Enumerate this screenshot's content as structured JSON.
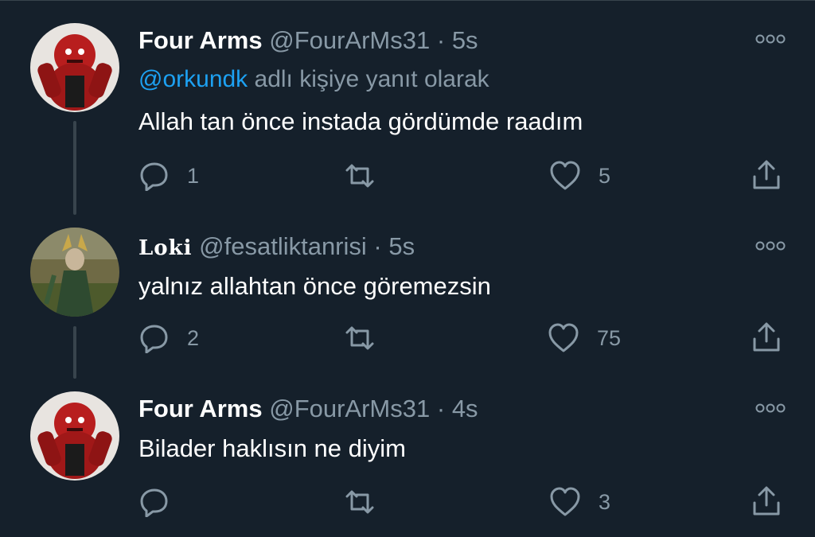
{
  "tweets": [
    {
      "name": "Four Arms",
      "handle": "@FourArMs31",
      "separator": "·",
      "time": "5s",
      "reply_mention": "@orkundk",
      "reply_suffix": " adlı kişiye yanıt olarak",
      "text": "Allah tan önce instada gördümde raadım",
      "reply_count": "1",
      "retweet_count": "",
      "like_count": "5"
    },
    {
      "name": "Loki",
      "handle": "@fesatliktanrisi",
      "separator": "·",
      "time": "5s",
      "text": "yalnız allahtan önce göremezsin",
      "reply_count": "2",
      "retweet_count": "",
      "like_count": "75"
    },
    {
      "name": "Four Arms",
      "handle": "@FourArMs31",
      "separator": "·",
      "time": "4s",
      "text": "Bilader haklısın ne diyim",
      "reply_count": "",
      "retweet_count": "",
      "like_count": "3"
    }
  ],
  "icons": {
    "reply": "reply-icon",
    "retweet": "retweet-icon",
    "like": "heart-icon",
    "share": "share-icon",
    "more": "more-options-icon"
  },
  "colors": {
    "background": "#15202b",
    "secondary_text": "#8899a6",
    "link": "#1da1f2"
  }
}
